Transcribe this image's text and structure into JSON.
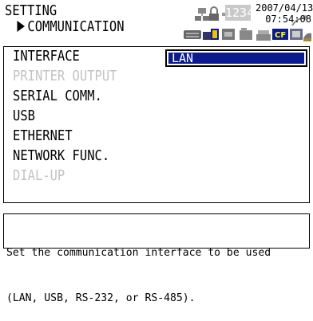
{
  "header": {
    "title_line1": "SETTING",
    "title_line2": "COMMUNICATION",
    "display_counter": "1234",
    "date": "2007/04/13",
    "time": "07:54:08",
    "icons": [
      "network-icon",
      "lock-icon",
      "speaker-icon",
      "keyboard-icon",
      "usb-icon",
      "ethernet-icon",
      "folder-icon",
      "printer-icon",
      "cf-card-icon",
      "memory-card-icon",
      "satellite-icon",
      "fax-icon"
    ]
  },
  "menu": {
    "items": [
      {
        "label": "INTERFACE",
        "enabled": true
      },
      {
        "label": "PRINTER OUTPUT",
        "enabled": false
      },
      {
        "label": "SERIAL COMM.",
        "enabled": true
      },
      {
        "label": "USB",
        "enabled": true
      },
      {
        "label": "ETHERNET",
        "enabled": true
      },
      {
        "label": "NETWORK FUNC.",
        "enabled": true
      },
      {
        "label": "DIAL-UP",
        "enabled": false
      }
    ],
    "interface_value": "LAN"
  },
  "help": {
    "line1": "Set the communication interface to be used",
    "line2": "(LAN, USB, RS-232, or RS-485)."
  },
  "colors": {
    "selection": "#0b1a8c",
    "disabled_text": "#c3c3c3"
  }
}
